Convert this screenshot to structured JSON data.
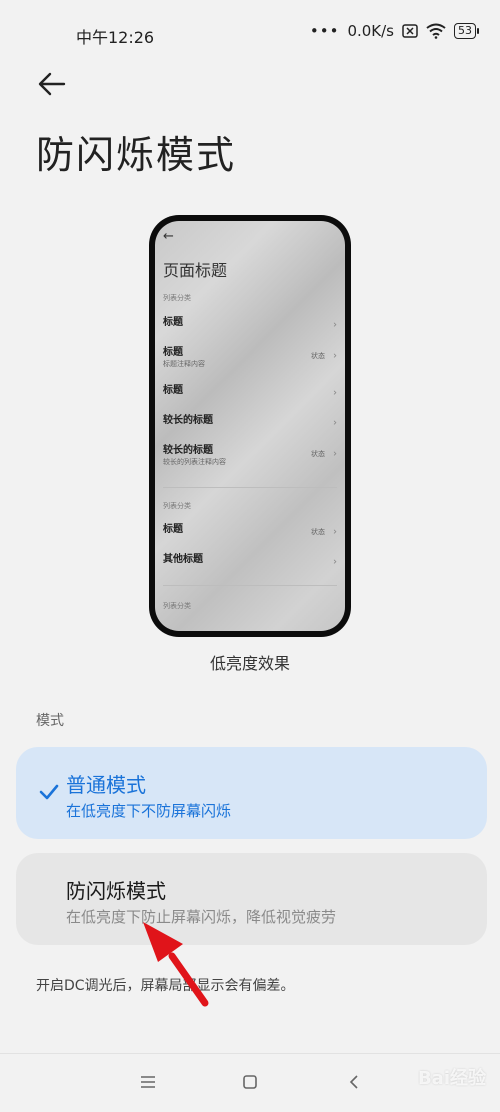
{
  "status_bar": {
    "time": "中午12:26",
    "network_speed": "0.0K/s",
    "battery": "53",
    "icons": [
      "sim-off-icon",
      "wifi-icon",
      "battery-icon"
    ]
  },
  "header": {
    "back_icon": "arrow-left-icon",
    "title": "防闪烁模式"
  },
  "preview": {
    "page_title": "页面标题",
    "section1": "列表分类",
    "rows1": [
      {
        "title": "标题",
        "subtitle": "",
        "status": ""
      },
      {
        "title": "标题",
        "subtitle": "标题注释内容",
        "status": "状态"
      },
      {
        "title": "标题",
        "subtitle": "",
        "status": ""
      },
      {
        "title": "较长的标题",
        "subtitle": "",
        "status": ""
      },
      {
        "title": "较长的标题",
        "subtitle": "较长的列表注释内容",
        "status": "状态"
      }
    ],
    "section2": "列表分类",
    "rows2": [
      {
        "title": "标题",
        "subtitle": "",
        "status": "状态"
      },
      {
        "title": "其他标题",
        "subtitle": "",
        "status": ""
      }
    ],
    "section3": "列表分类",
    "caption": "低亮度效果"
  },
  "mode_section": {
    "label": "模式",
    "options": [
      {
        "title": "普通模式",
        "subtitle": "在低亮度下不防屏幕闪烁",
        "selected": true
      },
      {
        "title": "防闪烁模式",
        "subtitle": "在低亮度下防止屏幕闪烁，降低视觉疲劳",
        "selected": false
      }
    ],
    "note": "开启DC调光后，屏幕局部显示会有偏差。"
  },
  "nav_bar": {
    "icons": [
      "menu-icon",
      "home-icon",
      "back-icon"
    ]
  },
  "watermark": "Bai经验",
  "colors": {
    "accent": "#1a73d9",
    "selected_card": "#d7e6f7",
    "card": "#e6e6e6",
    "annotation_arrow": "#e0141a"
  }
}
